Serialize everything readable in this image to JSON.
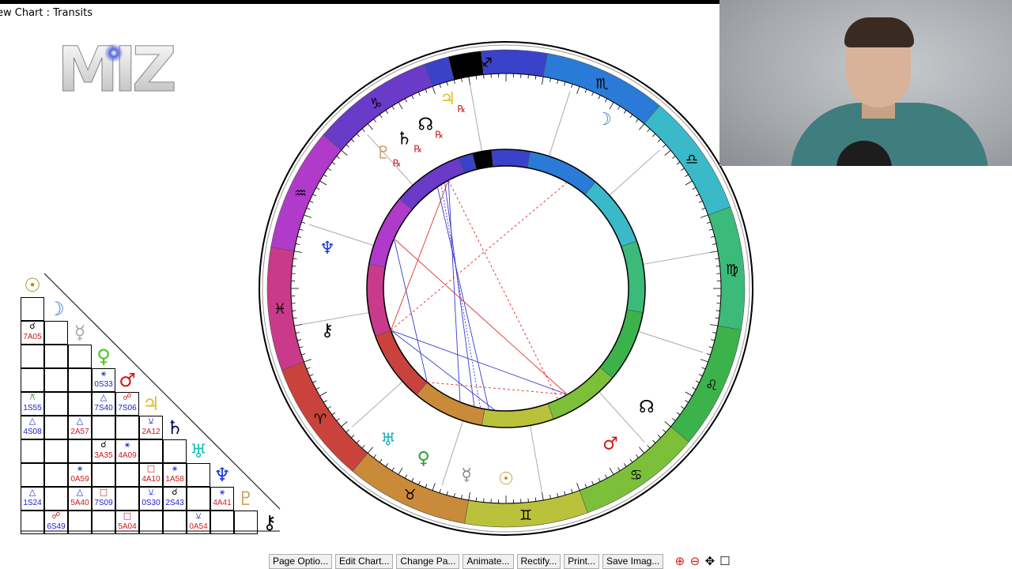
{
  "window": {
    "title": "ew Chart : Transits"
  },
  "logo": {
    "text": "MIZ"
  },
  "chart": {
    "signs": [
      {
        "glyph": "♈",
        "color": "#c9423c"
      },
      {
        "glyph": "♉",
        "color": "#c98a3a"
      },
      {
        "glyph": "♊",
        "color": "#b9c23a"
      },
      {
        "glyph": "♋",
        "color": "#7cc03a"
      },
      {
        "glyph": "♌",
        "color": "#3cb24a"
      },
      {
        "glyph": "♍",
        "color": "#3cba7a"
      },
      {
        "glyph": "♎",
        "color": "#3ab9c9"
      },
      {
        "glyph": "♏",
        "color": "#2a7bd8"
      },
      {
        "glyph": "♐",
        "color": "#3a42c9"
      },
      {
        "glyph": "♑",
        "color": "#6a3ac9"
      },
      {
        "glyph": "♒",
        "color": "#b03ac9"
      },
      {
        "glyph": "♓",
        "color": "#c93a8a"
      }
    ],
    "outer_planets": [
      {
        "glyph": "♆",
        "icon": "neptune-icon",
        "color": "#000000",
        "rx": ""
      },
      {
        "glyph": "♃",
        "icon": "jupiter-icon",
        "color": "#e0c020",
        "rx": "℞"
      },
      {
        "glyph": "☊",
        "icon": "node-icon",
        "color": "#000000",
        "rx": "℞"
      },
      {
        "glyph": "♄",
        "icon": "saturn-icon",
        "color": "#000000",
        "rx": "℞"
      },
      {
        "glyph": "♇",
        "icon": "pluto-icon",
        "color": "#d0a060",
        "rx": "℞"
      },
      {
        "glyph": "☽",
        "icon": "moon-icon",
        "color": "#3a7ad8",
        "rx": ""
      },
      {
        "glyph": "♆",
        "icon": "neptune-icon",
        "color": "#1a3ad0",
        "rx": ""
      },
      {
        "glyph": "⚷",
        "icon": "chiron-icon",
        "color": "#000000",
        "rx": ""
      },
      {
        "glyph": "☊",
        "icon": "node-icon",
        "color": "#000000",
        "rx": ""
      },
      {
        "glyph": "♂",
        "icon": "mars-icon",
        "color": "#d01a1a",
        "rx": ""
      },
      {
        "glyph": "♀",
        "icon": "venus-icon",
        "color": "#2aa02a",
        "rx": ""
      },
      {
        "glyph": "♅",
        "icon": "uranus-icon",
        "color": "#20b0b0",
        "rx": ""
      },
      {
        "glyph": "☿",
        "icon": "mercury-icon",
        "color": "#888888",
        "rx": ""
      },
      {
        "glyph": "☉",
        "icon": "sun-icon",
        "color": "#c09020",
        "rx": ""
      }
    ]
  },
  "aspect_grid": {
    "planets": [
      {
        "glyph": "☉",
        "color": "#b08a1a"
      },
      {
        "glyph": "☽",
        "color": "#3a7ad8"
      },
      {
        "glyph": "☿",
        "color": "#aaaaaa"
      },
      {
        "glyph": "♀",
        "color": "#4ac81a"
      },
      {
        "glyph": "♂",
        "color": "#d01a1a"
      },
      {
        "glyph": "♃",
        "color": "#e0c020"
      },
      {
        "glyph": "♄",
        "color": "#000060"
      },
      {
        "glyph": "♅",
        "color": "#20c0c0"
      },
      {
        "glyph": "♆",
        "color": "#1a3ad0"
      },
      {
        "glyph": "♇",
        "color": "#d0a060"
      },
      {
        "glyph": "⚷",
        "color": "#000000"
      }
    ],
    "cells": [
      {
        "r": 2,
        "c": 0,
        "sym": "☌",
        "val": "7A05",
        "sc": "black",
        "vc": "red"
      },
      {
        "r": 4,
        "c": 3,
        "sym": "⚹",
        "val": "0S33",
        "sc": "blue",
        "vc": "blue"
      },
      {
        "r": 5,
        "c": 0,
        "sym": "⚻",
        "val": "1S55",
        "sc": "green",
        "vc": "blue"
      },
      {
        "r": 5,
        "c": 3,
        "sym": "△",
        "val": "7S40",
        "sc": "blue",
        "vc": "blue"
      },
      {
        "r": 5,
        "c": 4,
        "sym": "☍",
        "val": "7S06",
        "sc": "red",
        "vc": "blue"
      },
      {
        "r": 6,
        "c": 0,
        "sym": "△",
        "val": "4S08",
        "sc": "blue",
        "vc": "blue"
      },
      {
        "r": 6,
        "c": 2,
        "sym": "△",
        "val": "2A57",
        "sc": "blue",
        "vc": "red"
      },
      {
        "r": 6,
        "c": 5,
        "sym": "⚺",
        "val": "2A12",
        "sc": "blue",
        "vc": "red"
      },
      {
        "r": 7,
        "c": 3,
        "sym": "☌",
        "val": "3A35",
        "sc": "black",
        "vc": "red"
      },
      {
        "r": 7,
        "c": 4,
        "sym": "⚹",
        "val": "4A09",
        "sc": "blue",
        "vc": "red"
      },
      {
        "r": 8,
        "c": 2,
        "sym": "⚹",
        "val": "0A59",
        "sc": "blue",
        "vc": "red"
      },
      {
        "r": 8,
        "c": 5,
        "sym": "□",
        "val": "4A10",
        "sc": "red",
        "vc": "red"
      },
      {
        "r": 8,
        "c": 6,
        "sym": "⚹",
        "val": "1A58",
        "sc": "blue",
        "vc": "red"
      },
      {
        "r": 9,
        "c": 0,
        "sym": "△",
        "val": "1S24",
        "sc": "blue",
        "vc": "blue"
      },
      {
        "r": 9,
        "c": 2,
        "sym": "△",
        "val": "5A40",
        "sc": "blue",
        "vc": "red"
      },
      {
        "r": 9,
        "c": 3,
        "sym": "□",
        "val": "7S09",
        "sc": "red",
        "vc": "blue"
      },
      {
        "r": 9,
        "c": 5,
        "sym": "⚺",
        "val": "0S30",
        "sc": "blue",
        "vc": "blue"
      },
      {
        "r": 9,
        "c": 6,
        "sym": "☌",
        "val": "2S43",
        "sc": "black",
        "vc": "blue"
      },
      {
        "r": 9,
        "c": 8,
        "sym": "⚹",
        "val": "4A41",
        "sc": "blue",
        "vc": "red"
      },
      {
        "r": 10,
        "c": 1,
        "sym": "☍",
        "val": "6S49",
        "sc": "red",
        "vc": "blue"
      },
      {
        "r": 10,
        "c": 4,
        "sym": "□",
        "val": "5A04",
        "sc": "red",
        "vc": "red"
      },
      {
        "r": 10,
        "c": 7,
        "sym": "⚺",
        "val": "0A54",
        "sc": "blue",
        "vc": "red"
      }
    ]
  },
  "toolbar": {
    "buttons": [
      {
        "label": "Page Optio...",
        "name": "page-options-button"
      },
      {
        "label": "Edit Chart...",
        "name": "edit-chart-button"
      },
      {
        "label": "Change Pa...",
        "name": "change-page-button"
      },
      {
        "label": "Animate...",
        "name": "animate-button"
      },
      {
        "label": "Rectify...",
        "name": "rectify-button"
      },
      {
        "label": "Print...",
        "name": "print-button"
      },
      {
        "label": "Save Imag...",
        "name": "save-image-button"
      }
    ],
    "icons": [
      {
        "glyph": "⊕",
        "name": "zoom-in-icon",
        "color": "#d01a1a"
      },
      {
        "glyph": "⊖",
        "name": "zoom-out-icon",
        "color": "#d01a1a"
      },
      {
        "glyph": "✥",
        "name": "pan-icon",
        "color": "#000000"
      },
      {
        "glyph": "☐",
        "name": "fit-frame-icon",
        "color": "#000000"
      }
    ]
  }
}
